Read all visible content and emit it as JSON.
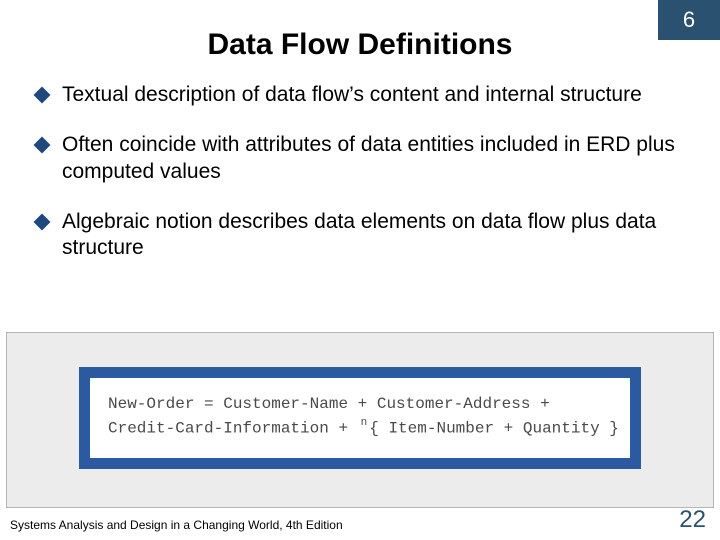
{
  "pageBadge": "6",
  "title": "Data Flow Definitions",
  "bullets": [
    "Textual description of data flow’s content and internal structure",
    "Often coincide with attributes of data entities included in ERD plus computed values",
    "Algebraic notion describes data elements on data flow plus data structure"
  ],
  "code": {
    "line1": "New-Order = Customer-Name + Customer-Address +",
    "line2a": "Credit-Card-Information + ",
    "line2b": "{ Item-Number + Quantity }",
    "star": "n"
  },
  "footer": "Systems Analysis and Design in a Changing World, 4th Edition",
  "slideNumber": "22"
}
